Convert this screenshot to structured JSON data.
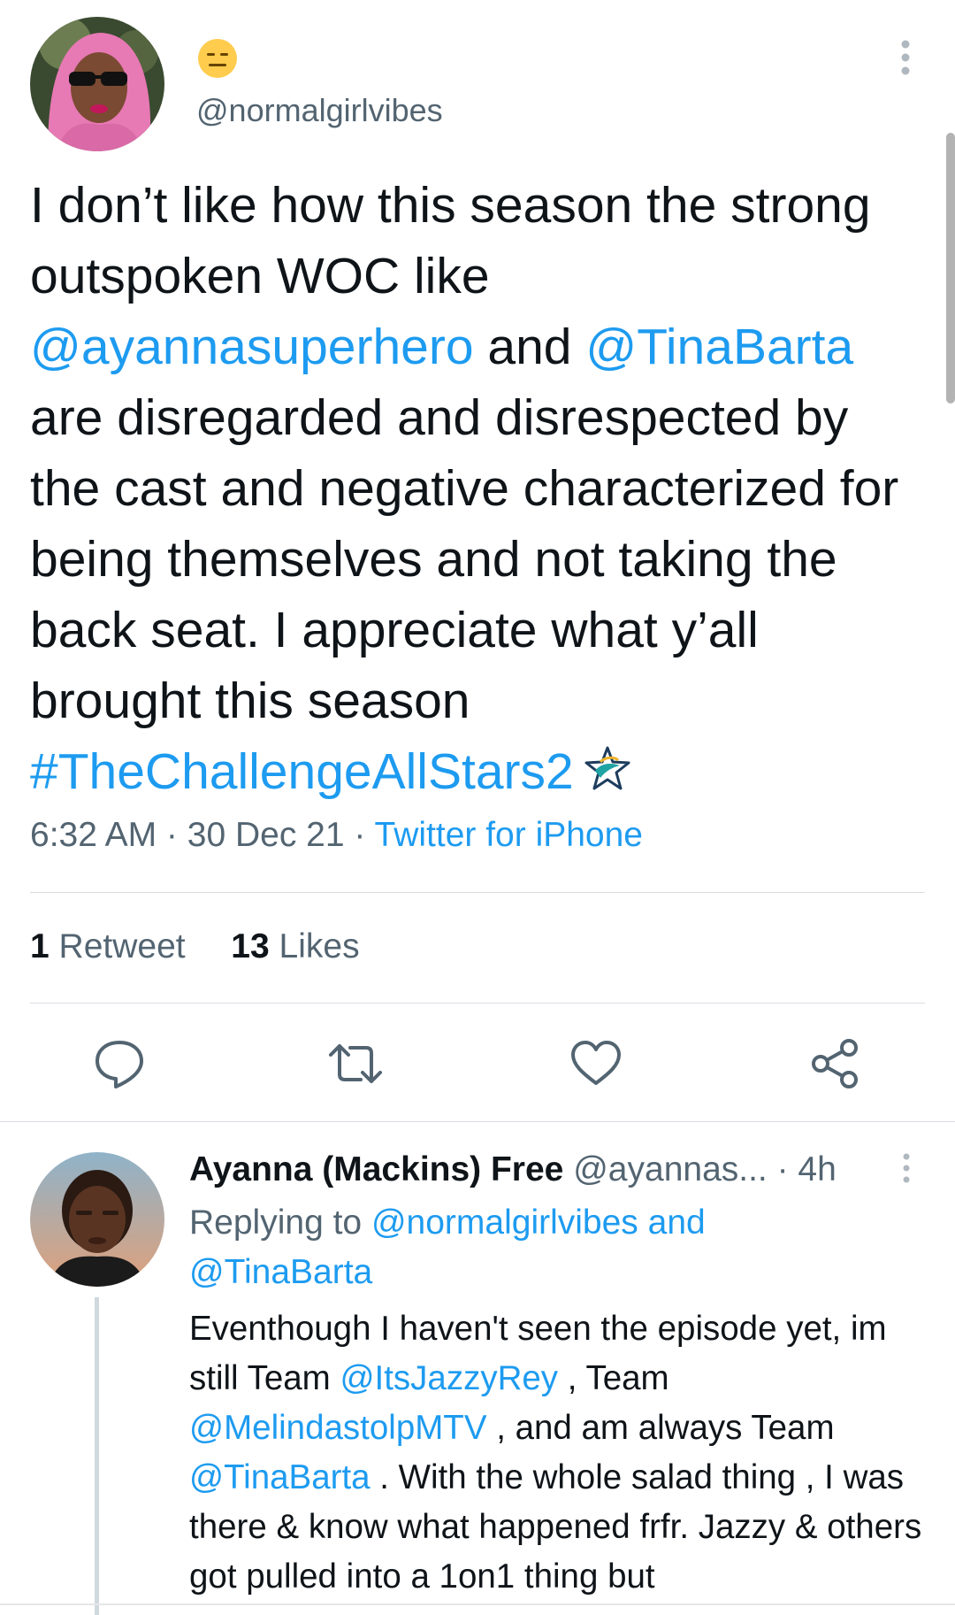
{
  "tweet": {
    "emoji_name": "expressionless-face-emoji",
    "handle": "@normalgirlvibes",
    "text": {
      "t1": "I don’t like how this season the strong outspoken WOC like ",
      "m1": "@ayannasuperhero",
      "t2": " and ",
      "m2": "@TinaBarta",
      "t3": " are disregarded and disrespected by the cast and negative characterized for being themselves and not taking the back seat. I appreciate what y’all brought this season ",
      "hashtag": "#TheChallengeAllStars2"
    },
    "time": "6:32 AM",
    "sep1": " · ",
    "date": "30 Dec 21",
    "sep2": " · ",
    "source": "Twitter for iPhone",
    "retweets_count": "1",
    "retweets_label": " Retweet",
    "likes_count": "13",
    "likes_label": " Likes"
  },
  "actions": {
    "reply_icon": "reply-icon",
    "retweet_icon": "retweet-icon",
    "like_icon": "like-icon",
    "share_icon": "share-icon"
  },
  "reply": {
    "name": "Ayanna (Mackins) Free",
    "handle": "@ayannas...",
    "time": " · 4h",
    "replying_prefix": "Replying to ",
    "replying_user1": "@normalgirlvibes",
    "replying_and": " and",
    "replying_user2": "@TinaBarta",
    "text": {
      "t1": "Eventhough I haven't seen the episode yet, im still Team ",
      "m1": "@ItsJazzyRey",
      "t2": " , Team ",
      "m2": "@MelindastolpMTV",
      "t3": " , and am always Team ",
      "m3": "@TinaBarta",
      "t4": " . With the whole salad thing , I was there & know what happened frfr. Jazzy & others got pulled into a 1on1 thing but"
    }
  },
  "colors": {
    "link": "#1d9bf0",
    "muted": "#536471",
    "text": "#0f1419",
    "divider": "#d9dde1"
  }
}
